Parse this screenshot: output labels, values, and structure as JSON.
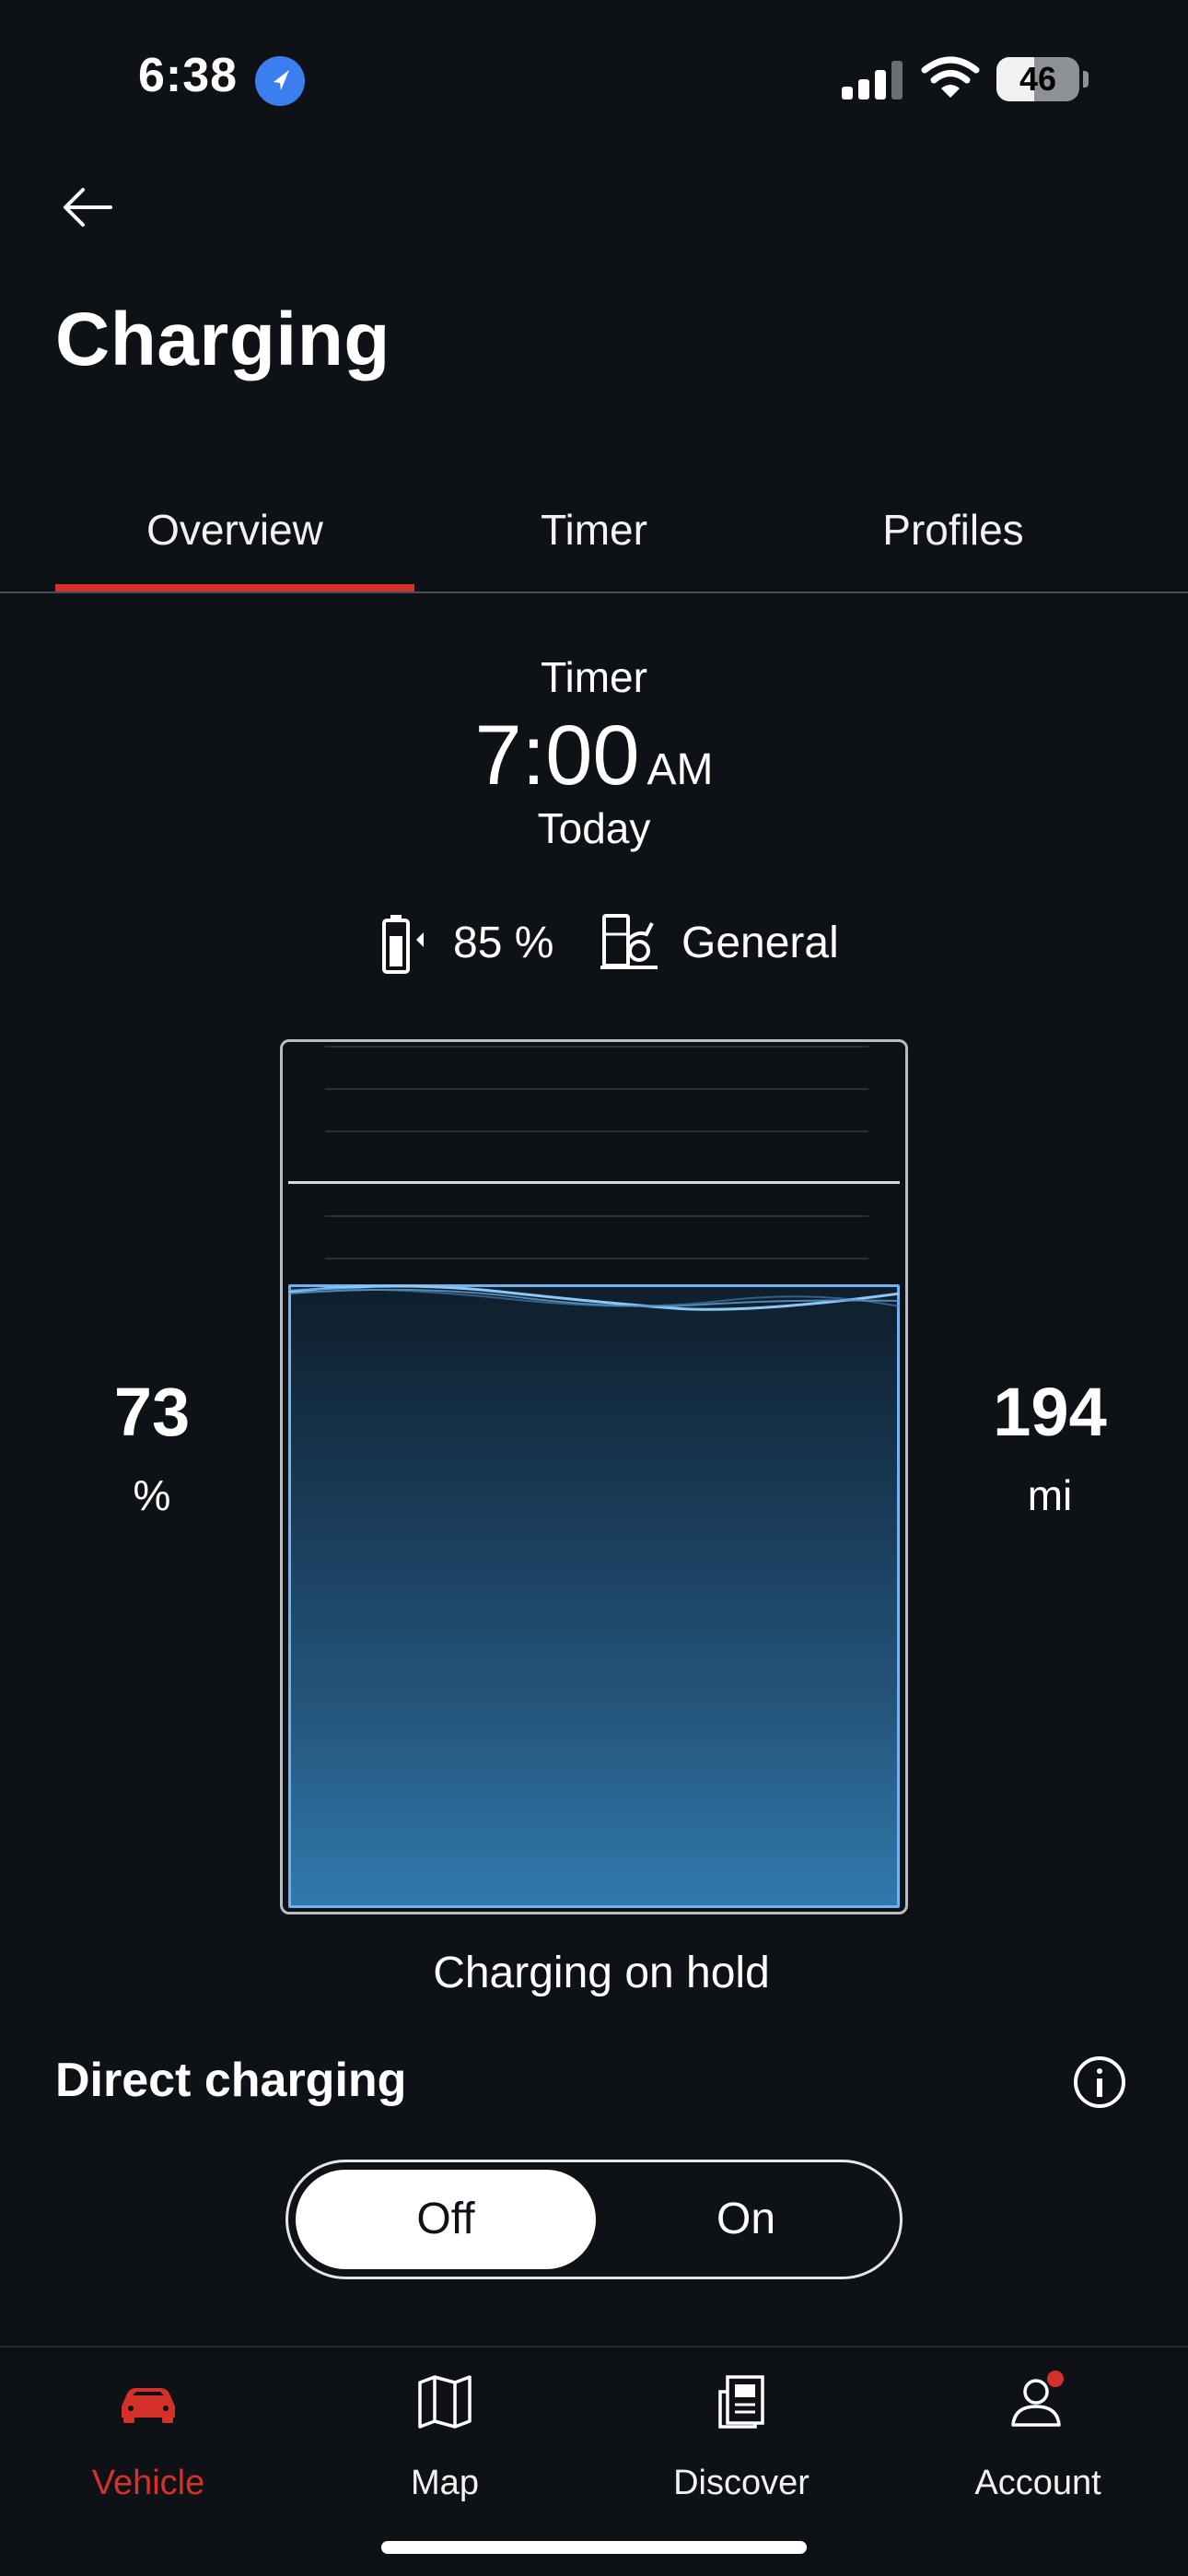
{
  "status_bar": {
    "time": "6:38",
    "battery_level": "46",
    "battery_fraction": 0.46
  },
  "header": {
    "back_icon": "arrow-left-icon",
    "title": "Charging"
  },
  "tabs": [
    {
      "label": "Overview",
      "active": true
    },
    {
      "label": "Timer",
      "active": false
    },
    {
      "label": "Profiles",
      "active": false
    }
  ],
  "timer": {
    "label": "Timer",
    "time": "7:00",
    "ampm": "AM",
    "day": "Today"
  },
  "target": {
    "percent": "85 %",
    "profile": "General"
  },
  "gauge": {
    "current_fraction": 0.73,
    "target_fraction": 0.85
  },
  "current_charge": {
    "value": "73",
    "unit": "%"
  },
  "range": {
    "value": "194",
    "unit": "mi"
  },
  "charging_status": "Charging on hold",
  "direct_charging": {
    "title": "Direct charging",
    "info_icon": "info-icon",
    "off_label": "Off",
    "on_label": "On",
    "selected": "Off"
  },
  "bottom_nav": [
    {
      "label": "Vehicle",
      "icon": "car-icon",
      "active": true
    },
    {
      "label": "Map",
      "icon": "map-icon",
      "active": false
    },
    {
      "label": "Discover",
      "icon": "news-icon",
      "active": false
    },
    {
      "label": "Account",
      "icon": "account-icon",
      "active": false
    }
  ],
  "colors": {
    "background": "#0e1217",
    "accent": "#d5312b",
    "charge_fill": "#3179ad"
  }
}
